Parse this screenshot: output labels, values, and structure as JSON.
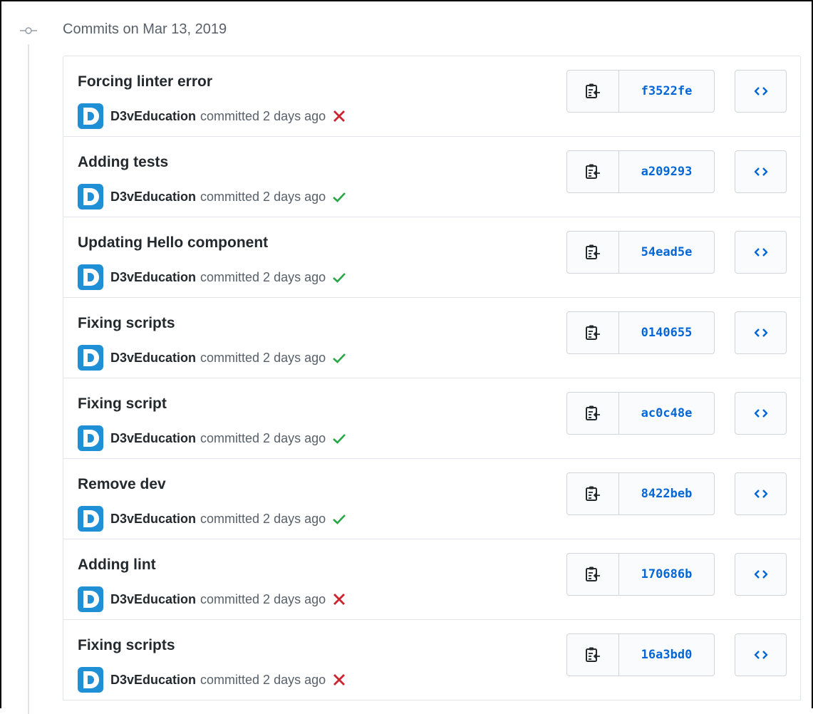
{
  "timeline": {
    "date_heading": "Commits on Mar 13, 2019"
  },
  "colors": {
    "link_blue": "#0366d6",
    "success_green": "#28a745",
    "failure_red": "#cb2431",
    "avatar_blue": "#1f8fd6"
  },
  "icons": {
    "copy": "clippy-icon",
    "browse": "code-icon",
    "success": "check-icon",
    "failure": "x-icon"
  },
  "commits": [
    {
      "title": "Forcing linter error",
      "author": "D3vEducation",
      "time": "committed 2 days ago",
      "status": "failure",
      "sha": "f3522fe"
    },
    {
      "title": "Adding tests",
      "author": "D3vEducation",
      "time": "committed 2 days ago",
      "status": "success",
      "sha": "a209293"
    },
    {
      "title": "Updating Hello component",
      "author": "D3vEducation",
      "time": "committed 2 days ago",
      "status": "success",
      "sha": "54ead5e"
    },
    {
      "title": "Fixing scripts",
      "author": "D3vEducation",
      "time": "committed 2 days ago",
      "status": "success",
      "sha": "0140655"
    },
    {
      "title": "Fixing script",
      "author": "D3vEducation",
      "time": "committed 2 days ago",
      "status": "success",
      "sha": "ac0c48e"
    },
    {
      "title": "Remove dev",
      "author": "D3vEducation",
      "time": "committed 2 days ago",
      "status": "success",
      "sha": "8422beb"
    },
    {
      "title": "Adding lint",
      "author": "D3vEducation",
      "time": "committed 2 days ago",
      "status": "failure",
      "sha": "170686b"
    },
    {
      "title": "Fixing scripts",
      "author": "D3vEducation",
      "time": "committed 2 days ago",
      "status": "failure",
      "sha": "16a3bd0"
    }
  ]
}
